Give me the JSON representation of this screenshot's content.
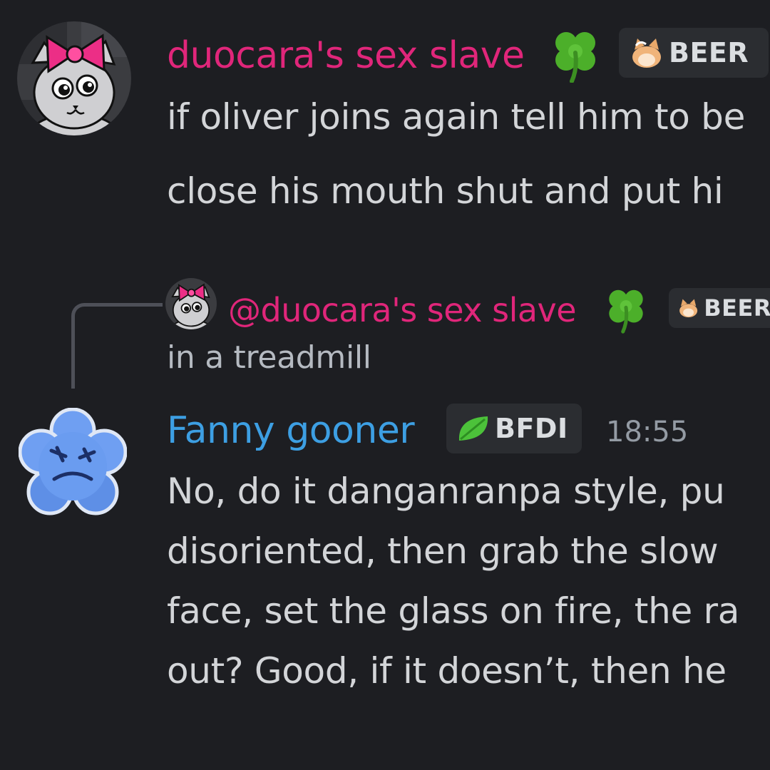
{
  "messages": [
    {
      "author": "duocara's sex slave",
      "author_color": "#e0267a",
      "author_emoji": "four-leaf-clover-icon",
      "tag": {
        "icon": "cat-icon",
        "label": "BEER"
      },
      "lines": [
        "if oliver joins again tell him to be",
        "close his mouth shut and put hi"
      ]
    },
    {
      "reply_to": {
        "mention": "@duocara's sex slave",
        "mention_color": "#e0267a",
        "author_emoji": "four-leaf-clover-icon",
        "tag": {
          "icon": "cat-icon",
          "label": "BEER"
        },
        "preview": "in a treadmill"
      },
      "author": "Fanny gooner",
      "author_color": "#3d9fe3",
      "tag": {
        "icon": "leaf-icon",
        "label": "BFDI"
      },
      "timestamp": "18:55",
      "lines": [
        "No, do it danganranpa style, pu",
        "disoriented, then grab the slow",
        "face, set the glass on fire, the ra",
        "out? Good, if it doesn’t, then he"
      ]
    }
  ]
}
